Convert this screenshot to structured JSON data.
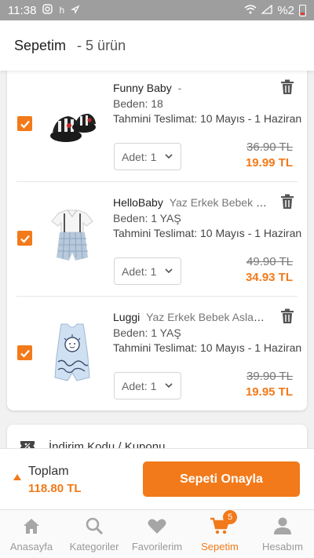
{
  "status_bar": {
    "time": "11:38",
    "battery": "%2"
  },
  "header": {
    "title": "Sepetim",
    "item_count": "- 5 ürün"
  },
  "cart": {
    "items": [
      {
        "brand": "Funny Baby",
        "name": "-",
        "size": "Beden: 18",
        "delivery": "Tahmini Teslimat: 10 Mayıs - 1 Haziran",
        "quantity": "Adet: 1",
        "old_price": "36.90 TL",
        "new_price": "19.99 TL",
        "checked": true
      },
      {
        "brand": "HelloBaby",
        "name": "Yaz Erkek Bebek Se...",
        "size": "Beden: 1 YAŞ",
        "delivery": "Tahmini Teslimat: 10 Mayıs - 1 Haziran",
        "quantity": "Adet: 1",
        "old_price": "49.90 TL",
        "new_price": "34.93 TL",
        "checked": true
      },
      {
        "brand": "Luggi",
        "name": "Yaz Erkek Bebek Aslan Kı...",
        "size": "Beden: 1 YAŞ",
        "delivery": "Tahmini Teslimat: 10 Mayıs - 1 Haziran",
        "quantity": "Adet: 1",
        "old_price": "39.90 TL",
        "new_price": "19.95 TL",
        "checked": true
      }
    ]
  },
  "coupon": {
    "label": "İndirim Kodu / Kuponu"
  },
  "summary": {
    "total_label": "Toplam",
    "total_value": "118.80 TL",
    "confirm_label": "Sepeti Onayla"
  },
  "bottom_nav": {
    "items": [
      {
        "label": "Anasayfa",
        "icon": "home-icon"
      },
      {
        "label": "Kategoriler",
        "icon": "search-icon"
      },
      {
        "label": "Favorilerim",
        "icon": "heart-icon"
      },
      {
        "label": "Sepetim",
        "icon": "cart-icon",
        "active": true,
        "badge": "5"
      },
      {
        "label": "Hesabım",
        "icon": "user-icon"
      }
    ]
  },
  "colors": {
    "accent": "#f27a1a",
    "status_bar": "#9e9e9e"
  }
}
